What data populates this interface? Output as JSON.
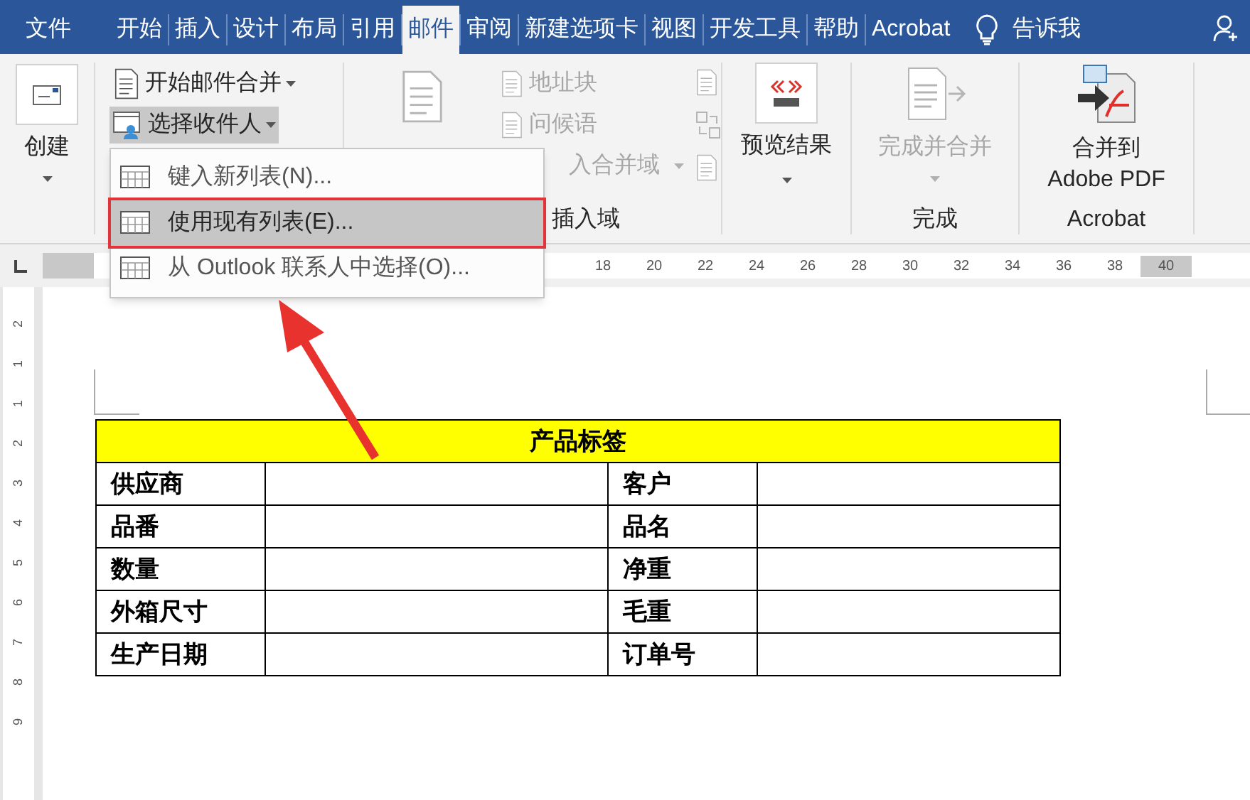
{
  "tabs": [
    {
      "label": "文件",
      "selected": false
    },
    {
      "label": "开始",
      "selected": false
    },
    {
      "label": "插入",
      "selected": false
    },
    {
      "label": "设计",
      "selected": false
    },
    {
      "label": "布局",
      "selected": false
    },
    {
      "label": "引用",
      "selected": false
    },
    {
      "label": "邮件",
      "selected": true
    },
    {
      "label": "审阅",
      "selected": false
    },
    {
      "label": "新建选项卡",
      "selected": false
    },
    {
      "label": "视图",
      "selected": false
    },
    {
      "label": "开发工具",
      "selected": false
    },
    {
      "label": "帮助",
      "selected": false
    },
    {
      "label": "Acrobat",
      "selected": false
    }
  ],
  "tell_me": "告诉我",
  "ribbon": {
    "create": {
      "label": "创建",
      "disabled": false
    },
    "start_merge": {
      "label": "开始邮件合并",
      "disabled": false,
      "pressed": false
    },
    "select_recipients": {
      "label": "选择收件人",
      "disabled": false,
      "pressed": true
    },
    "write_insert": {
      "items": [
        {
          "label": "地址块",
          "disabled": true
        },
        {
          "label": "问候语",
          "disabled": true
        },
        {
          "label": "入合并域",
          "disabled": true
        }
      ],
      "group_label": "插入域"
    },
    "preview": {
      "label": "预览结果",
      "disabled": false
    },
    "finish": {
      "label": "完成并合并",
      "disabled": true,
      "group_label": "完成"
    },
    "acrobat": {
      "label": "合并到",
      "label_2": "Adobe PDF",
      "disabled": false,
      "group_label": "Acrobat"
    }
  },
  "menu": [
    {
      "label": "键入新列表(N)...",
      "selected": false
    },
    {
      "label": "使用现有列表(E)...",
      "selected": true
    },
    {
      "label": "从 Outlook 联系人中选择(O)...",
      "selected": false
    }
  ],
  "ruler": {
    "ticks": [
      "18",
      "20",
      "22",
      "24",
      "26",
      "28",
      "30",
      "32",
      "34",
      "36",
      "38",
      "40"
    ],
    "vertical_ticks": [
      "2",
      "1",
      "1",
      "2",
      "3",
      "4",
      "5",
      "6",
      "7",
      "8",
      "9"
    ]
  },
  "table": {
    "title": "产品标签",
    "rows": [
      [
        "供应商",
        "",
        "客户",
        ""
      ],
      [
        "品番",
        "",
        "品名",
        ""
      ],
      [
        "数量",
        "",
        "净重",
        ""
      ],
      [
        "外箱尺寸",
        "",
        "毛重",
        ""
      ],
      [
        "生产日期",
        "",
        "订单号",
        ""
      ]
    ]
  }
}
